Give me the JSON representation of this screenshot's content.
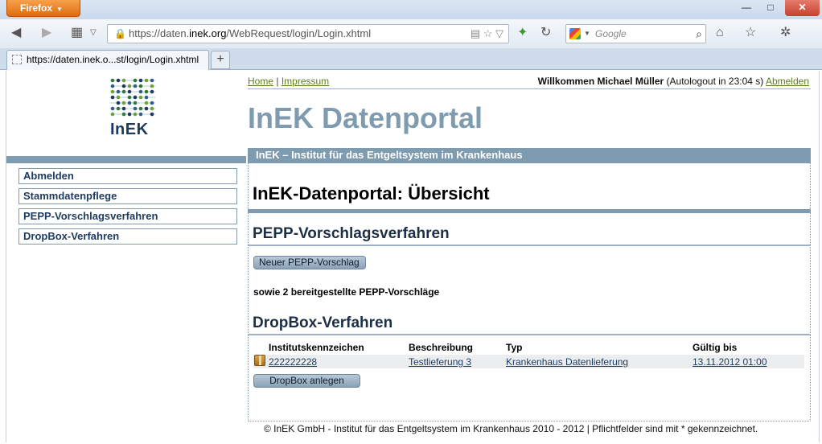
{
  "browser": {
    "app_button": "Firefox",
    "url_prefix": "https://daten.",
    "url_domain": "inek.org",
    "url_path": "/WebRequest/login/Login.xhtml",
    "search_placeholder": "Google",
    "tab_title": "https://daten.inek.o...st/login/Login.xhtml",
    "new_tab": "+"
  },
  "logo": {
    "text": "InEK"
  },
  "toplinks": {
    "home": "Home",
    "separator": "|",
    "impressum": "Impressum"
  },
  "welcome": {
    "greeting": "Willkommen Michael Müller",
    "autologout": "(Autologout in   23:04 s)",
    "logout": "Abmelden"
  },
  "portal_title": "InEK Datenportal",
  "institute_bar": "InEK – Institut für das Entgeltsystem im Krankenhaus",
  "sidebar": {
    "items": [
      {
        "label": "Abmelden"
      },
      {
        "label": "Stammdatenpflege"
      },
      {
        "label": "PEPP-Vorschlagsverfahren"
      },
      {
        "label": "DropBox-Verfahren"
      }
    ]
  },
  "main": {
    "heading": "InEK-Datenportal: Übersicht",
    "pepp": {
      "heading": "PEPP-Vorschlagsverfahren",
      "button": "Neuer PEPP-Vorschlag",
      "info": "sowie 2 bereitgestellte PEPP-Vorschläge"
    },
    "dropbox": {
      "heading": "DropBox-Verfahren",
      "columns": [
        "Institutskennzeichen",
        "Beschreibung",
        "Typ",
        "Gültig bis"
      ],
      "rows": [
        {
          "ik": "222222228",
          "beschreibung": "Testlieferung 3",
          "typ": "Krankenhaus Datenlieferung",
          "gueltig": "13.11.2012 01:00"
        }
      ],
      "button": "DropBox anlegen"
    }
  },
  "footer": "© InEK GmbH - Institut für das Entgeltsystem im Krankenhaus 2010 - 2012 | Pflichtfelder sind mit * gekennzeichnet.",
  "colors": {
    "accent": "#7f9bb0",
    "navy": "#1d3a5f",
    "link_green": "#5a7f1a",
    "firefox_orange": "#e06b10"
  }
}
